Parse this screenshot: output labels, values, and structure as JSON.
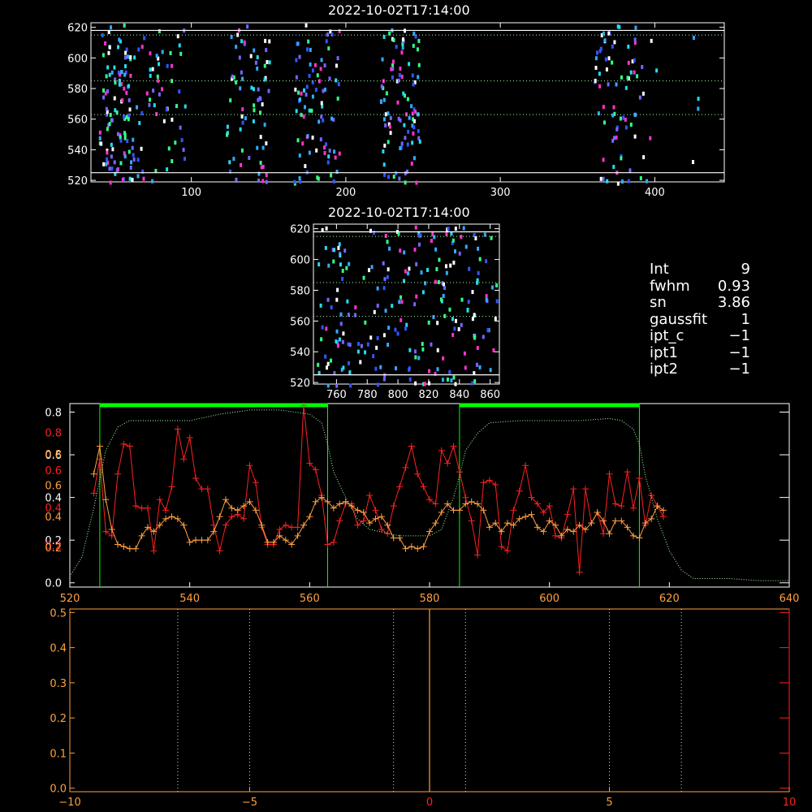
{
  "colors": {
    "background": "#000000",
    "axis_white": "#ffffff",
    "red": "#ff2020",
    "orange": "#ffa040",
    "green": "#00ff00",
    "light_green": "#a8ffa8",
    "grey": "#bbbbbb",
    "pixel_palette": [
      "#3355ff",
      "#33aaff",
      "#22ddee",
      "#33ff88",
      "#ff33cc",
      "#ffffff",
      "#7766ff"
    ]
  },
  "panel1": {
    "title": "2022-10-02T17:14:00",
    "xlim": [
      35,
      445
    ],
    "ylim": [
      519,
      623
    ],
    "xticks": [
      100,
      200,
      300,
      400
    ],
    "yticks": [
      520,
      540,
      560,
      580,
      600,
      620
    ],
    "white_hlines": [
      525,
      618
    ],
    "green_dotted_hlines": [
      563,
      585,
      615
    ],
    "pixel_columns": [
      {
        "x": [
          40,
          60
        ],
        "count": 100
      },
      {
        "x": [
          60,
          78
        ],
        "count": 35
      },
      {
        "x": [
          78,
          96
        ],
        "count": 28
      },
      {
        "x": [
          122,
          150
        ],
        "count": 70
      },
      {
        "x": [
          166,
          196
        ],
        "count": 85
      },
      {
        "x": [
          222,
          248
        ],
        "count": 95
      },
      {
        "x": [
          360,
          392
        ],
        "count": 75
      },
      {
        "x": [
          394,
          402
        ],
        "count": 4
      },
      {
        "x": [
          420,
          432
        ],
        "count": 4
      }
    ]
  },
  "panel2": {
    "title": "2022-10-02T17:14:00",
    "xlim": [
      745,
      866
    ],
    "ylim": [
      519,
      623
    ],
    "xticks": [
      760,
      780,
      800,
      820,
      840,
      860
    ],
    "yticks": [
      520,
      540,
      560,
      580,
      600,
      620
    ],
    "white_hlines": [
      525,
      618
    ],
    "green_dotted_hlines": [
      563,
      585,
      615
    ],
    "pixel_count": 230
  },
  "info": [
    {
      "name": "Int",
      "value": "9"
    },
    {
      "name": "fwhm",
      "value": "0.93"
    },
    {
      "name": "sn",
      "value": "3.86"
    },
    {
      "name": "gaussfit",
      "value": "1"
    },
    {
      "name": "ipt_c",
      "value": "−1"
    },
    {
      "name": "ipt1",
      "value": "−1"
    },
    {
      "name": "ipt2",
      "value": "−1"
    }
  ],
  "chart_data": [
    {
      "type": "line",
      "xlim": [
        520,
        640
      ],
      "ylim": [
        -0.02,
        0.84
      ],
      "xticks": [
        520,
        540,
        560,
        580,
        600,
        620,
        640
      ],
      "left_axis_labels_white": [
        0.0,
        0.2,
        0.4,
        0.6,
        0.8
      ],
      "left_axis_labels_orange": [
        0.2,
        0.4,
        0.6,
        0.8
      ],
      "left_axis_labels_orange_alt": [
        0.2,
        0.4,
        0.6,
        0.8
      ],
      "green_bars": [
        [
          525,
          563
        ],
        [
          585,
          615
        ]
      ],
      "series": [
        {
          "name": "",
          "style": "red-plus",
          "x": [
            524,
            525,
            526,
            527,
            528,
            529,
            530,
            531,
            532,
            533,
            534,
            535,
            536,
            537,
            538,
            539,
            540,
            541,
            542,
            543,
            544,
            545,
            546,
            547,
            548,
            549,
            550,
            551,
            552,
            553,
            554,
            555,
            556,
            557,
            558,
            559,
            560,
            561,
            562,
            563,
            564,
            565,
            566,
            567,
            568,
            569,
            570,
            571,
            572,
            573,
            574,
            575,
            576,
            577,
            578,
            579,
            580,
            581,
            582,
            583,
            584,
            585,
            586,
            587,
            588,
            589,
            590,
            591,
            592,
            593,
            594,
            595,
            596,
            597,
            598,
            599,
            600,
            601,
            602,
            603,
            604,
            605,
            606,
            607,
            608,
            609,
            610,
            611,
            612,
            613,
            614,
            615,
            616,
            617,
            618,
            619
          ],
          "y": [
            0.42,
            0.58,
            0.24,
            0.22,
            0.51,
            0.65,
            0.64,
            0.36,
            0.35,
            0.35,
            0.15,
            0.39,
            0.34,
            0.45,
            0.72,
            0.58,
            0.68,
            0.49,
            0.44,
            0.44,
            0.27,
            0.15,
            0.27,
            0.31,
            0.32,
            0.3,
            0.55,
            0.47,
            0.26,
            0.18,
            0.18,
            0.25,
            0.27,
            0.26,
            0.26,
            0.83,
            0.56,
            0.53,
            0.41,
            0.18,
            0.19,
            0.29,
            0.37,
            0.37,
            0.27,
            0.29,
            0.41,
            0.34,
            0.25,
            0.23,
            0.36,
            0.45,
            0.54,
            0.64,
            0.51,
            0.45,
            0.39,
            0.37,
            0.62,
            0.56,
            0.64,
            0.52,
            0.4,
            0.29,
            0.13,
            0.47,
            0.48,
            0.46,
            0.17,
            0.15,
            0.34,
            0.43,
            0.55,
            0.4,
            0.37,
            0.33,
            0.36,
            0.22,
            0.21,
            0.32,
            0.44,
            0.05,
            0.44,
            0.28,
            0.33,
            0.23,
            0.51,
            0.37,
            0.36,
            0.52,
            0.35,
            0.49,
            0.27,
            0.41,
            0.36,
            0.31
          ]
        },
        {
          "name": "",
          "style": "orange-plus",
          "x": [
            524,
            525,
            526,
            527,
            528,
            529,
            530,
            531,
            532,
            533,
            534,
            535,
            536,
            537,
            538,
            539,
            540,
            541,
            542,
            543,
            544,
            545,
            546,
            547,
            548,
            549,
            550,
            551,
            552,
            553,
            554,
            555,
            556,
            557,
            558,
            559,
            560,
            561,
            562,
            563,
            564,
            565,
            566,
            567,
            568,
            569,
            570,
            571,
            572,
            573,
            574,
            575,
            576,
            577,
            578,
            579,
            580,
            581,
            582,
            583,
            584,
            585,
            586,
            587,
            588,
            589,
            590,
            591,
            592,
            593,
            594,
            595,
            596,
            597,
            598,
            599,
            600,
            601,
            602,
            603,
            604,
            605,
            606,
            607,
            608,
            609,
            610,
            611,
            612,
            613,
            614,
            615,
            616,
            617,
            618,
            619
          ],
          "y": [
            0.51,
            0.64,
            0.39,
            0.25,
            0.18,
            0.17,
            0.16,
            0.16,
            0.22,
            0.26,
            0.24,
            0.27,
            0.3,
            0.31,
            0.3,
            0.27,
            0.19,
            0.2,
            0.2,
            0.2,
            0.24,
            0.31,
            0.39,
            0.35,
            0.34,
            0.36,
            0.38,
            0.34,
            0.27,
            0.19,
            0.19,
            0.22,
            0.2,
            0.18,
            0.22,
            0.27,
            0.31,
            0.38,
            0.4,
            0.38,
            0.35,
            0.37,
            0.38,
            0.36,
            0.34,
            0.33,
            0.28,
            0.3,
            0.31,
            0.27,
            0.21,
            0.21,
            0.16,
            0.17,
            0.16,
            0.17,
            0.24,
            0.28,
            0.33,
            0.37,
            0.34,
            0.34,
            0.37,
            0.38,
            0.37,
            0.34,
            0.26,
            0.28,
            0.24,
            0.28,
            0.27,
            0.3,
            0.31,
            0.32,
            0.26,
            0.24,
            0.29,
            0.27,
            0.22,
            0.25,
            0.24,
            0.27,
            0.25,
            0.28,
            0.33,
            0.29,
            0.23,
            0.29,
            0.29,
            0.26,
            0.22,
            0.21,
            0.28,
            0.3,
            0.36,
            0.34
          ]
        },
        {
          "name": "",
          "style": "green-dotted",
          "x": [
            520,
            522,
            524,
            526,
            528,
            530,
            535,
            540,
            545,
            550,
            555,
            560,
            562,
            563,
            564,
            566,
            568,
            570,
            575,
            580,
            582,
            584,
            585,
            586,
            588,
            590,
            595,
            600,
            605,
            610,
            612,
            614,
            615,
            616,
            618,
            620,
            622,
            624,
            626,
            630,
            635,
            640
          ],
          "y": [
            0.03,
            0.12,
            0.35,
            0.62,
            0.73,
            0.76,
            0.76,
            0.76,
            0.79,
            0.81,
            0.81,
            0.79,
            0.75,
            0.65,
            0.52,
            0.4,
            0.3,
            0.25,
            0.22,
            0.22,
            0.25,
            0.4,
            0.5,
            0.62,
            0.7,
            0.75,
            0.76,
            0.76,
            0.76,
            0.77,
            0.76,
            0.72,
            0.65,
            0.5,
            0.3,
            0.15,
            0.06,
            0.02,
            0.02,
            0.02,
            0.01,
            0.01
          ]
        }
      ]
    },
    {
      "type": "line",
      "xlim": [
        -10,
        10
      ],
      "ylim": [
        -0.01,
        0.51
      ],
      "xticks": [
        -10,
        -5,
        0,
        5,
        10
      ],
      "yticks": [
        0.0,
        0.1,
        0.2,
        0.3,
        0.4,
        0.5
      ],
      "vertical_dotted": [
        -7,
        -5,
        -1,
        1,
        5,
        7
      ],
      "center_line": 0
    }
  ]
}
